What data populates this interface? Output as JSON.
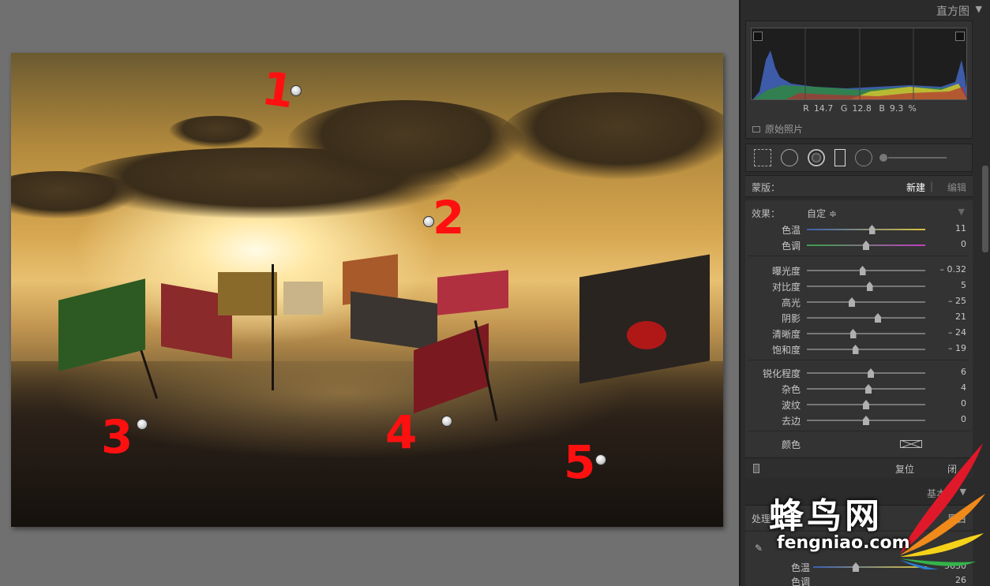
{
  "panel": {
    "title": "直方图",
    "title_arrow": "▼",
    "histogram": {
      "r_label": "R",
      "r_value": "14.7",
      "g_label": "G",
      "g_value": "12.8",
      "b_label": "B",
      "b_value": "9.3",
      "unit": "%",
      "original_label": "原始照片"
    },
    "mask": {
      "label": "蒙版：",
      "new": "新建",
      "separator": "|",
      "edit": "编辑"
    },
    "effect": {
      "label": "效果：",
      "value": "自定 ≑",
      "arrow": "▼"
    },
    "sliders": [
      {
        "label": "色温",
        "value": "11",
        "pos": 0.55
      },
      {
        "label": "色调",
        "value": "0",
        "pos": 0.5
      },
      {
        "label": "曝光度",
        "value": "– 0.32",
        "pos": 0.47
      },
      {
        "label": "对比度",
        "value": "5",
        "pos": 0.53
      },
      {
        "label": "高光",
        "value": "– 25",
        "pos": 0.38
      },
      {
        "label": "阴影",
        "value": "21",
        "pos": 0.6
      },
      {
        "label": "清晰度",
        "value": "– 24",
        "pos": 0.39
      },
      {
        "label": "饱和度",
        "value": "– 19",
        "pos": 0.41
      },
      {
        "label": "锐化程度",
        "value": "6",
        "pos": 0.54
      },
      {
        "label": "杂色",
        "value": "4",
        "pos": 0.52
      },
      {
        "label": "波纹",
        "value": "0",
        "pos": 0.5
      },
      {
        "label": "去边",
        "value": "0",
        "pos": 0.5
      }
    ],
    "color_label": "颜色",
    "reset": "复位",
    "close": "闭",
    "basic": "基本",
    "basic_arrow": "▼",
    "process_label": "处理",
    "bw": "黑白",
    "wb": {
      "label": "色温",
      "value": "5630",
      "tint_label": "色调",
      "tint_value": "26"
    }
  },
  "photo_marks": [
    "1",
    "2",
    "3",
    "4",
    "5"
  ],
  "watermark": {
    "title": "蜂鸟网",
    "url": "fengniao.com"
  },
  "colors": {
    "panel_bg": "#2b2b2b",
    "mark_red": "#ff1010",
    "canvas_bg": "#707070"
  }
}
